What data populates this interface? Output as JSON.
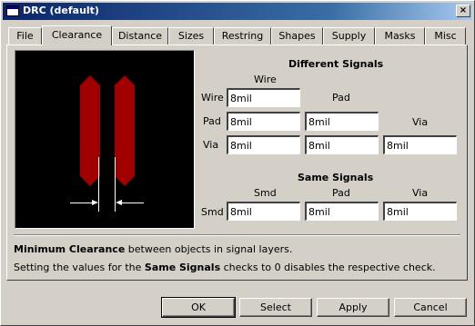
{
  "window": {
    "title": "DRC (default)"
  },
  "title_buttons": {
    "close": "×"
  },
  "tabs": [
    {
      "label": "File"
    },
    {
      "label": "Clearance"
    },
    {
      "label": "Distance"
    },
    {
      "label": "Sizes"
    },
    {
      "label": "Restring"
    },
    {
      "label": "Shapes"
    },
    {
      "label": "Supply"
    },
    {
      "label": "Masks"
    },
    {
      "label": "Misc"
    }
  ],
  "active_tab": "Clearance",
  "different_signals": {
    "heading": "Different Signals",
    "col_wire": "Wire",
    "col_pad": "Pad",
    "col_via": "Via",
    "row_wire": "Wire",
    "row_pad": "Pad",
    "row_via": "Via",
    "wire_wire": "8mil",
    "pad_wire": "8mil",
    "pad_pad": "8mil",
    "via_wire": "8mil",
    "via_pad": "8mil",
    "via_via": "8mil"
  },
  "same_signals": {
    "heading": "Same Signals",
    "col_smd": "Smd",
    "col_pad": "Pad",
    "col_via": "Via",
    "row_smd": "Smd",
    "smd_smd": "8mil",
    "smd_pad": "8mil",
    "smd_via": "8mil"
  },
  "info": {
    "line1_bold": "Minimum Clearance",
    "line1_rest": " between objects in signal layers.",
    "line2_pre": "Setting the values for the ",
    "line2_bold": "Same Signals",
    "line2_post": " checks to 0 disables the respective check."
  },
  "buttons": {
    "ok": "OK",
    "select": "Select",
    "apply": "Apply",
    "cancel": "Cancel"
  },
  "colors": {
    "pad_fill": "#a00000",
    "preview_bg": "#000000",
    "dialog_bg": "#d4d0c8",
    "title_bar": "#0a246a"
  }
}
